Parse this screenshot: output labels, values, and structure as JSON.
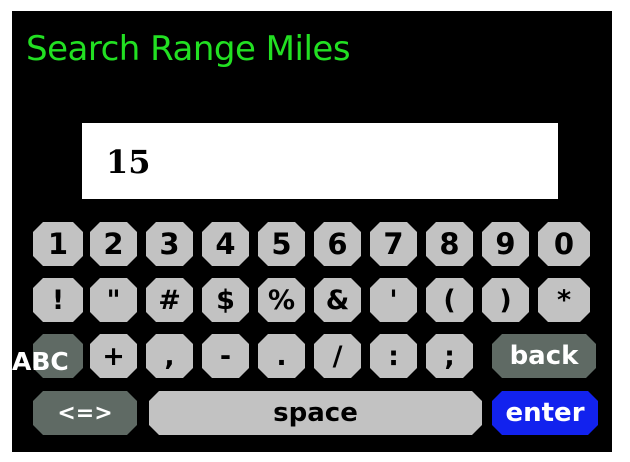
{
  "title": "Search Range Miles",
  "input": {
    "value": "15"
  },
  "keyboard": {
    "row1": [
      "1",
      "2",
      "3",
      "4",
      "5",
      "6",
      "7",
      "8",
      "9",
      "0"
    ],
    "row2": [
      "!",
      "\"",
      "#",
      "$",
      "%",
      "&",
      "'",
      "(",
      ")",
      "*"
    ],
    "row3": {
      "abc_label": "ABC",
      "keys": [
        "+",
        ",",
        "-",
        ".",
        "/",
        ":",
        ";"
      ],
      "back_label": "back"
    },
    "row4": {
      "toggle_label": "<=>",
      "space_label": "space",
      "enter_label": "enter"
    }
  },
  "colors": {
    "title": "#22e022",
    "key": "#c2c2c2",
    "dark_key": "#5f6a64",
    "enter_key": "#1222ee"
  }
}
